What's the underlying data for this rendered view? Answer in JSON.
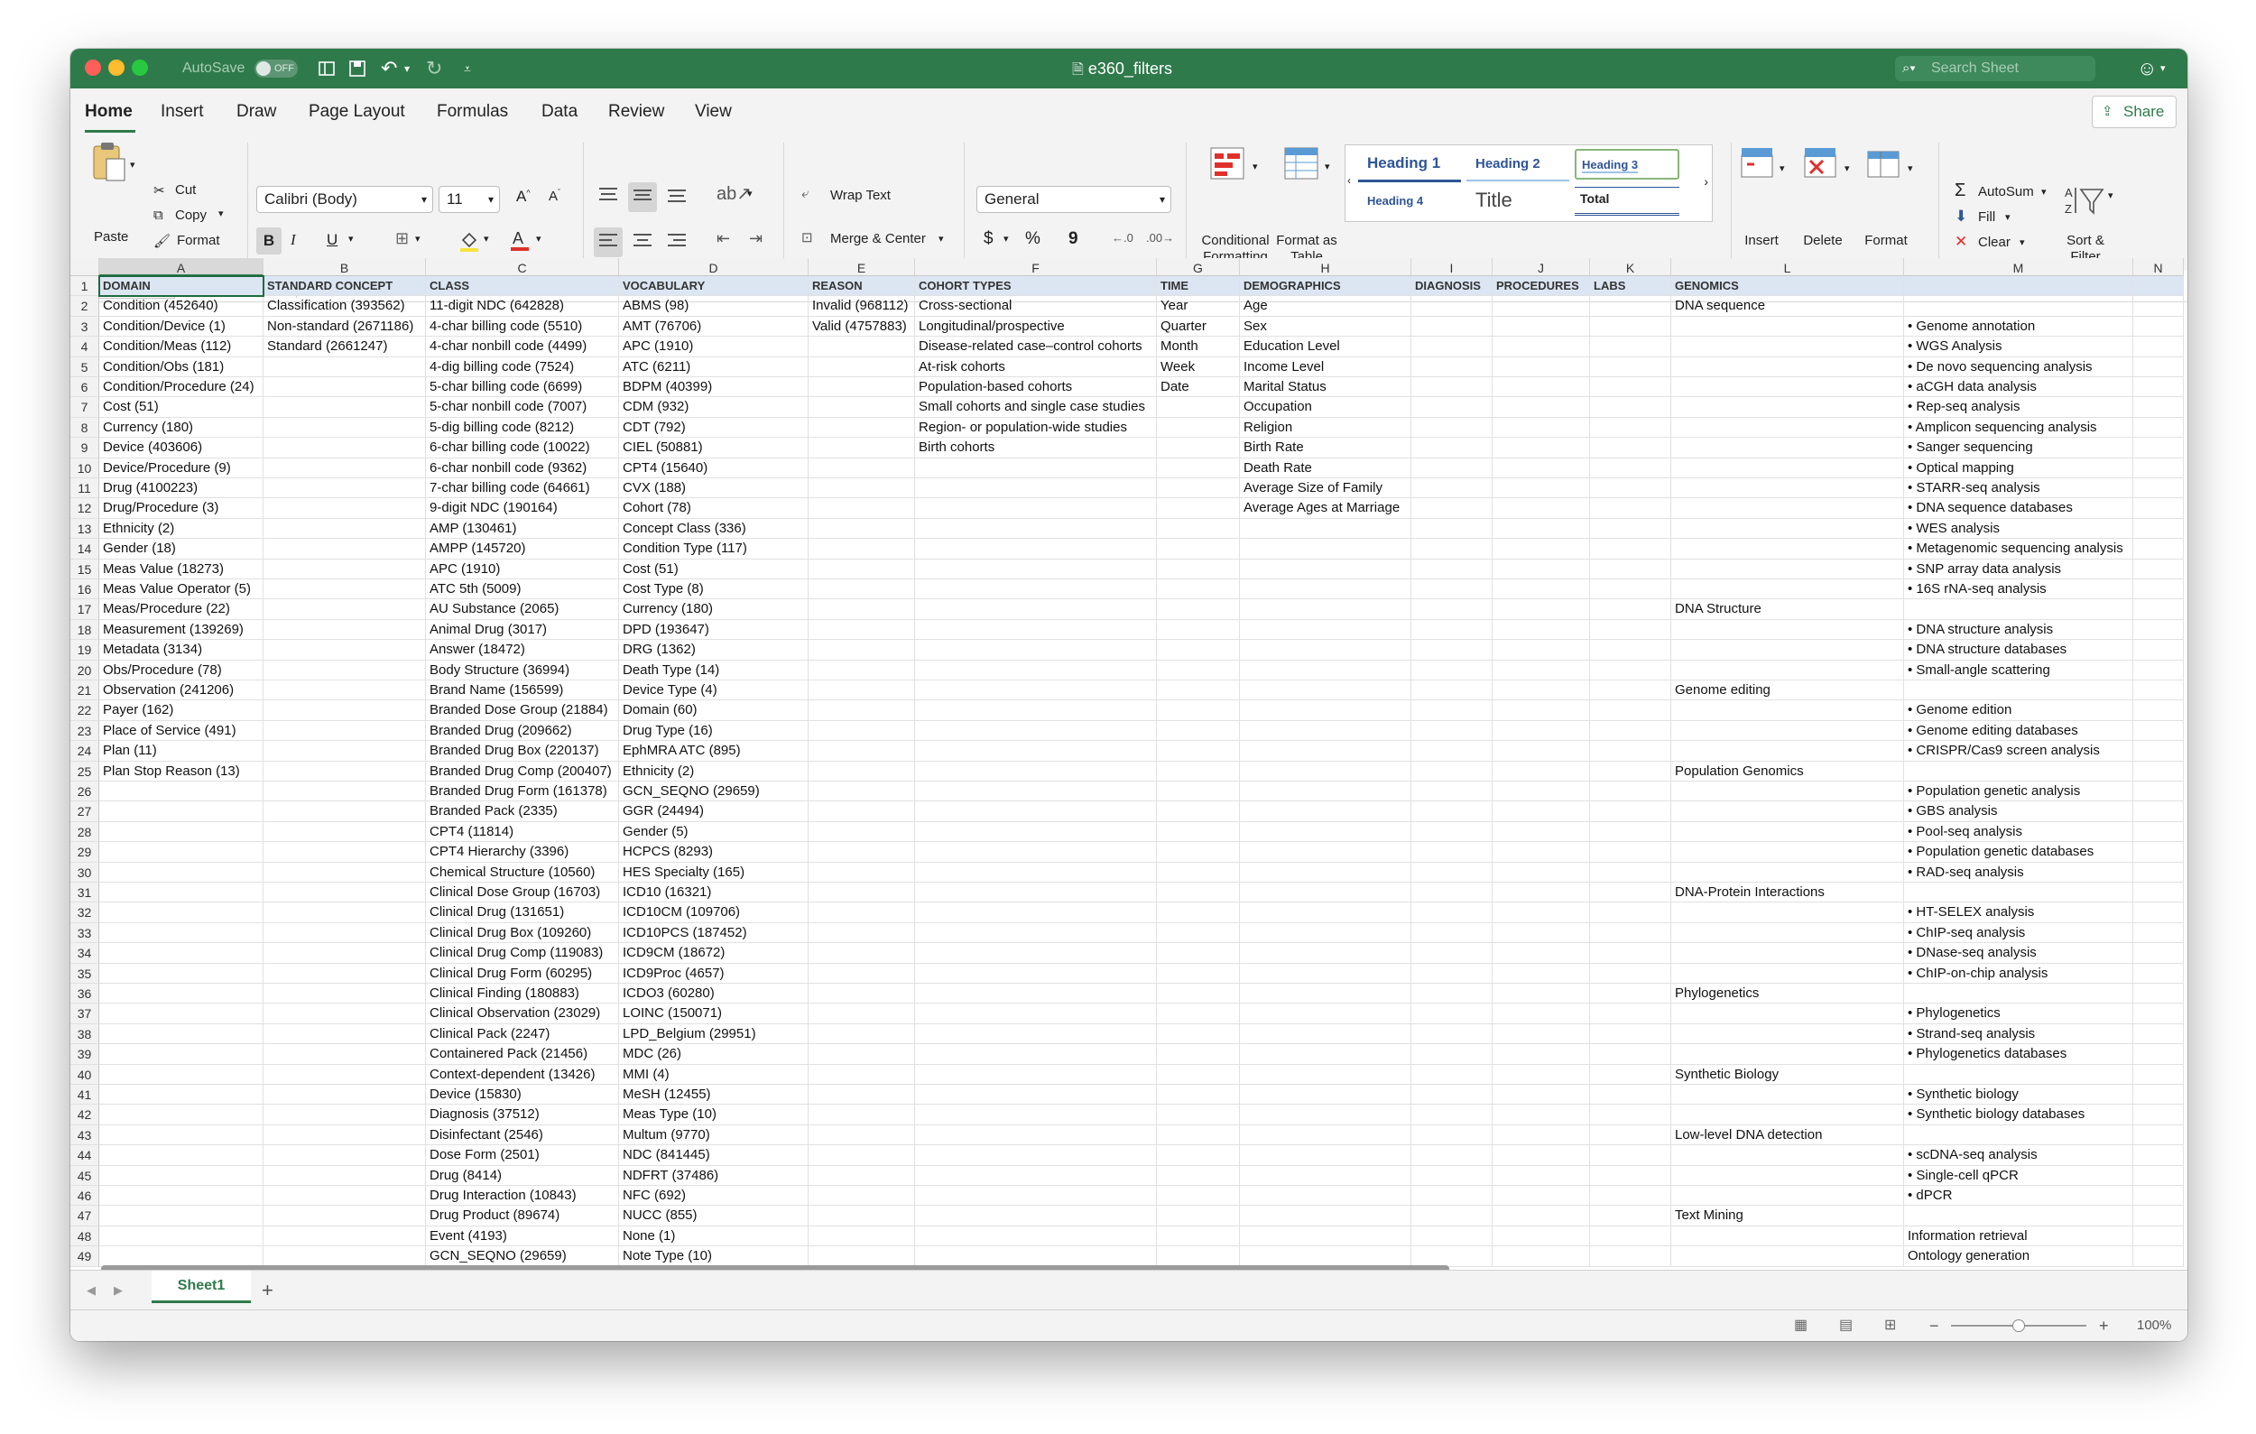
{
  "window": {
    "title": "e360_filters",
    "autosave_label": "AutoSave",
    "autosave_state": "OFF",
    "search_placeholder": "Search Sheet"
  },
  "ribbon_tabs": [
    "Home",
    "Insert",
    "Draw",
    "Page Layout",
    "Formulas",
    "Data",
    "Review",
    "View"
  ],
  "share_label": "Share",
  "ribbon": {
    "paste": "Paste",
    "cut": "Cut",
    "copy": "Copy",
    "format_painter": "Format",
    "font_name": "Calibri (Body)",
    "font_size": "11",
    "bold": "B",
    "italic": "I",
    "underline": "U",
    "wrap_text": "Wrap Text",
    "merge_center": "Merge & Center",
    "number_format": "General",
    "currency": "$",
    "percent": "%",
    "comma": "9",
    "conditional_formatting": "Conditional Formatting",
    "format_as_table": "Format as Table",
    "styles": [
      "Heading 1",
      "Heading 2",
      "Heading 3",
      "Heading 4",
      "Title",
      "Total"
    ],
    "insert": "Insert",
    "delete": "Delete",
    "format": "Format",
    "autosum": "AutoSum",
    "fill": "Fill",
    "clear": "Clear",
    "sort_filter": "Sort & Filter"
  },
  "formula_bar": {
    "name_box": "A1",
    "fx": "fx",
    "content": "DOMAIN"
  },
  "columns": [
    "A",
    "B",
    "C",
    "D",
    "E",
    "F",
    "G",
    "H",
    "I",
    "J",
    "K",
    "L",
    "M",
    "N"
  ],
  "row_numbers": [
    "1",
    "2",
    "3",
    "4",
    "5",
    "6",
    "7",
    "8",
    "9",
    "10",
    "11",
    "12",
    "13",
    "14",
    "15",
    "16",
    "17",
    "18",
    "19",
    "20",
    "21",
    "22",
    "23",
    "24",
    "25",
    "26",
    "27",
    "28",
    "29",
    "30",
    "31",
    "32",
    "33",
    "34",
    "35",
    "36",
    "37",
    "38",
    "39",
    "40",
    "41",
    "42",
    "43",
    "44",
    "45",
    "46",
    "47",
    "48",
    "49"
  ],
  "headers": [
    "DOMAIN",
    "STANDARD CONCEPT",
    "CLASS",
    "VOCABULARY",
    "REASON",
    "COHORT TYPES",
    "TIME",
    "DEMOGRAPHICS",
    "DIAGNOSIS",
    "PROCEDURES",
    "LABS",
    "GENOMICS",
    "",
    ""
  ],
  "rows": [
    [
      "Condition (452640)",
      "Classification (393562)",
      "11-digit NDC (642828)",
      "ABMS (98)",
      "Invalid (968112)",
      "Cross-sectional",
      "Year",
      "Age",
      "",
      "",
      "",
      "DNA sequence",
      "",
      ""
    ],
    [
      "Condition/Device (1)",
      "Non-standard (2671186)",
      "4-char billing code (5510)",
      "AMT (76706)",
      "Valid (4757883)",
      "Longitudinal/prospective",
      "Quarter",
      "Sex",
      "",
      "",
      "",
      "",
      "• Genome annotation",
      ""
    ],
    [
      "Condition/Meas (112)",
      "Standard (2661247)",
      "4-char nonbill code (4499)",
      "APC (1910)",
      "",
      "Disease-related case–control cohorts",
      "Month",
      "Education Level",
      "",
      "",
      "",
      "",
      "• WGS Analysis",
      ""
    ],
    [
      "Condition/Obs (181)",
      "",
      "4-dig billing code (7524)",
      "ATC (6211)",
      "",
      "At-risk cohorts",
      "Week",
      "Income Level",
      "",
      "",
      "",
      "",
      "• De novo sequencing analysis",
      ""
    ],
    [
      "Condition/Procedure (24)",
      "",
      "5-char billing code (6699)",
      "BDPM (40399)",
      "",
      "Population-based cohorts",
      "Date",
      "Marital Status",
      "",
      "",
      "",
      "",
      "• aCGH data analysis",
      ""
    ],
    [
      "Cost (51)",
      "",
      "5-char nonbill code (7007)",
      "CDM (932)",
      "",
      "Small cohorts and single case studies",
      "",
      "Occupation",
      "",
      "",
      "",
      "",
      "• Rep-seq analysis",
      ""
    ],
    [
      "Currency (180)",
      "",
      "5-dig billing code (8212)",
      "CDT (792)",
      "",
      "Region- or population-wide studies",
      "",
      "Religion",
      "",
      "",
      "",
      "",
      "• Amplicon sequencing analysis",
      ""
    ],
    [
      "Device (403606)",
      "",
      "6-char billing code (10022)",
      "CIEL (50881)",
      "",
      "Birth cohorts",
      "",
      "Birth Rate",
      "",
      "",
      "",
      "",
      "• Sanger sequencing",
      ""
    ],
    [
      "Device/Procedure (9)",
      "",
      "6-char nonbill code (9362)",
      "CPT4 (15640)",
      "",
      "",
      "",
      "Death Rate",
      "",
      "",
      "",
      "",
      "• Optical mapping",
      ""
    ],
    [
      "Drug (4100223)",
      "",
      "7-char billing code (64661)",
      "CVX (188)",
      "",
      "",
      "",
      "Average Size of Family",
      "",
      "",
      "",
      "",
      "• STARR-seq analysis",
      ""
    ],
    [
      "Drug/Procedure (3)",
      "",
      "9-digit NDC (190164)",
      "Cohort (78)",
      "",
      "",
      "",
      "Average Ages at Marriage",
      "",
      "",
      "",
      "",
      "• DNA sequence databases",
      ""
    ],
    [
      "Ethnicity (2)",
      "",
      "AMP (130461)",
      "Concept Class (336)",
      "",
      "",
      "",
      "",
      "",
      "",
      "",
      "",
      "• WES analysis",
      ""
    ],
    [
      "Gender (18)",
      "",
      "AMPP (145720)",
      "Condition Type (117)",
      "",
      "",
      "",
      "",
      "",
      "",
      "",
      "",
      "• Metagenomic sequencing analysis",
      ""
    ],
    [
      "Meas Value (18273)",
      "",
      "APC (1910)",
      "Cost (51)",
      "",
      "",
      "",
      "",
      "",
      "",
      "",
      "",
      "• SNP array data analysis",
      ""
    ],
    [
      "Meas Value Operator (5)",
      "",
      "ATC 5th (5009)",
      "Cost Type (8)",
      "",
      "",
      "",
      "",
      "",
      "",
      "",
      "",
      "• 16S rNA-seq analysis",
      ""
    ],
    [
      "Meas/Procedure (22)",
      "",
      "AU Substance (2065)",
      "Currency (180)",
      "",
      "",
      "",
      "",
      "",
      "",
      "",
      "DNA Structure",
      "",
      ""
    ],
    [
      "Measurement (139269)",
      "",
      "Animal Drug (3017)",
      "DPD (193647)",
      "",
      "",
      "",
      "",
      "",
      "",
      "",
      "",
      "• DNA structure analysis",
      ""
    ],
    [
      "Metadata (3134)",
      "",
      "Answer (18472)",
      "DRG (1362)",
      "",
      "",
      "",
      "",
      "",
      "",
      "",
      "",
      "• DNA structure databases",
      ""
    ],
    [
      "Obs/Procedure (78)",
      "",
      "Body Structure (36994)",
      "Death Type (14)",
      "",
      "",
      "",
      "",
      "",
      "",
      "",
      "",
      "• Small-angle scattering",
      ""
    ],
    [
      "Observation (241206)",
      "",
      "Brand Name (156599)",
      "Device Type (4)",
      "",
      "",
      "",
      "",
      "",
      "",
      "",
      "Genome editing",
      "",
      ""
    ],
    [
      "Payer (162)",
      "",
      "Branded Dose Group (21884)",
      "Domain (60)",
      "",
      "",
      "",
      "",
      "",
      "",
      "",
      "",
      "• Genome edition",
      ""
    ],
    [
      "Place of Service (491)",
      "",
      "Branded Drug (209662)",
      "Drug Type (16)",
      "",
      "",
      "",
      "",
      "",
      "",
      "",
      "",
      "• Genome editing databases",
      ""
    ],
    [
      "Plan (11)",
      "",
      "Branded Drug Box (220137)",
      "EphMRA ATC (895)",
      "",
      "",
      "",
      "",
      "",
      "",
      "",
      "",
      "• CRISPR/Cas9 screen analysis",
      ""
    ],
    [
      "Plan Stop Reason (13)",
      "",
      "Branded Drug Comp (200407)",
      "Ethnicity (2)",
      "",
      "",
      "",
      "",
      "",
      "",
      "",
      "Population Genomics",
      "",
      ""
    ],
    [
      "",
      "",
      "Branded Drug Form (161378)",
      "GCN_SEQNO (29659)",
      "",
      "",
      "",
      "",
      "",
      "",
      "",
      "",
      "• Population genetic analysis",
      ""
    ],
    [
      "",
      "",
      "Branded Pack (2335)",
      "GGR (24494)",
      "",
      "",
      "",
      "",
      "",
      "",
      "",
      "",
      "• GBS analysis",
      ""
    ],
    [
      "",
      "",
      "CPT4 (11814)",
      "Gender (5)",
      "",
      "",
      "",
      "",
      "",
      "",
      "",
      "",
      "• Pool-seq analysis",
      ""
    ],
    [
      "",
      "",
      "CPT4 Hierarchy (3396)",
      "HCPCS (8293)",
      "",
      "",
      "",
      "",
      "",
      "",
      "",
      "",
      "• Population genetic databases",
      ""
    ],
    [
      "",
      "",
      "Chemical Structure (10560)",
      "HES Specialty (165)",
      "",
      "",
      "",
      "",
      "",
      "",
      "",
      "",
      "• RAD-seq analysis",
      ""
    ],
    [
      "",
      "",
      "Clinical Dose Group (16703)",
      "ICD10 (16321)",
      "",
      "",
      "",
      "",
      "",
      "",
      "",
      "DNA-Protein Interactions",
      "",
      ""
    ],
    [
      "",
      "",
      "Clinical Drug (131651)",
      "ICD10CM (109706)",
      "",
      "",
      "",
      "",
      "",
      "",
      "",
      "",
      "• HT-SELEX analysis",
      ""
    ],
    [
      "",
      "",
      "Clinical Drug Box (109260)",
      "ICD10PCS (187452)",
      "",
      "",
      "",
      "",
      "",
      "",
      "",
      "",
      "• ChIP-seq analysis",
      ""
    ],
    [
      "",
      "",
      "Clinical Drug Comp (119083)",
      "ICD9CM (18672)",
      "",
      "",
      "",
      "",
      "",
      "",
      "",
      "",
      "• DNase-seq analysis",
      ""
    ],
    [
      "",
      "",
      "Clinical Drug Form (60295)",
      "ICD9Proc (4657)",
      "",
      "",
      "",
      "",
      "",
      "",
      "",
      "",
      "• ChIP-on-chip analysis",
      ""
    ],
    [
      "",
      "",
      "Clinical Finding (180883)",
      "ICDO3 (60280)",
      "",
      "",
      "",
      "",
      "",
      "",
      "",
      "Phylogenetics",
      "",
      ""
    ],
    [
      "",
      "",
      "Clinical Observation (23029)",
      "LOINC (150071)",
      "",
      "",
      "",
      "",
      "",
      "",
      "",
      "",
      "• Phylogenetics",
      ""
    ],
    [
      "",
      "",
      "Clinical Pack (2247)",
      "LPD_Belgium (29951)",
      "",
      "",
      "",
      "",
      "",
      "",
      "",
      "",
      "• Strand-seq analysis",
      ""
    ],
    [
      "",
      "",
      "Containered Pack (21456)",
      "MDC (26)",
      "",
      "",
      "",
      "",
      "",
      "",
      "",
      "",
      "• Phylogenetics databases",
      ""
    ],
    [
      "",
      "",
      "Context-dependent (13426)",
      "MMI (4)",
      "",
      "",
      "",
      "",
      "",
      "",
      "",
      "Synthetic Biology",
      "",
      ""
    ],
    [
      "",
      "",
      "Device (15830)",
      "MeSH (12455)",
      "",
      "",
      "",
      "",
      "",
      "",
      "",
      "",
      "• Synthetic biology",
      ""
    ],
    [
      "",
      "",
      "Diagnosis (37512)",
      "Meas Type (10)",
      "",
      "",
      "",
      "",
      "",
      "",
      "",
      "",
      "• Synthetic biology databases",
      ""
    ],
    [
      "",
      "",
      "Disinfectant (2546)",
      "Multum (9770)",
      "",
      "",
      "",
      "",
      "",
      "",
      "",
      "Low-level DNA detection",
      "",
      ""
    ],
    [
      "",
      "",
      "Dose Form (2501)",
      "NDC (841445)",
      "",
      "",
      "",
      "",
      "",
      "",
      "",
      "",
      "• scDNA-seq analysis",
      ""
    ],
    [
      "",
      "",
      "Drug (8414)",
      "NDFRT (37486)",
      "",
      "",
      "",
      "",
      "",
      "",
      "",
      "",
      "• Single-cell qPCR",
      ""
    ],
    [
      "",
      "",
      "Drug Interaction (10843)",
      "NFC (692)",
      "",
      "",
      "",
      "",
      "",
      "",
      "",
      "",
      "• dPCR",
      ""
    ],
    [
      "",
      "",
      "Drug Product (89674)",
      "NUCC (855)",
      "",
      "",
      "",
      "",
      "",
      "",
      "",
      "Text Mining",
      "",
      ""
    ],
    [
      "",
      "",
      "Event (4193)",
      "None (1)",
      "",
      "",
      "",
      "",
      "",
      "",
      "",
      "",
      "Information retrieval",
      ""
    ],
    [
      "",
      "",
      "GCN_SEQNO (29659)",
      "Note Type (10)",
      "",
      "",
      "",
      "",
      "",
      "",
      "",
      "",
      "Ontology generation",
      ""
    ]
  ],
  "sheet_tab": "Sheet1",
  "add_sheet": "+",
  "zoom": "100%"
}
